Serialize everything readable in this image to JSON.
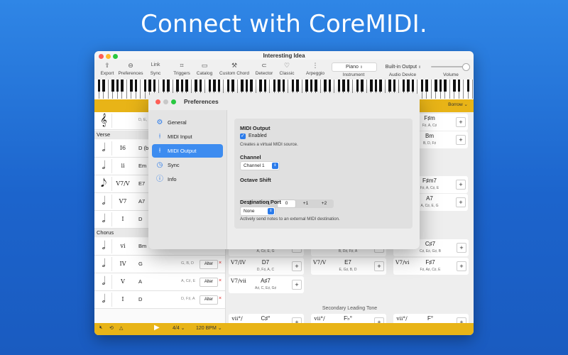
{
  "headline": "Connect with CoreMIDI.",
  "window": {
    "title": "Interesting Idea",
    "traffic_colors": [
      "#fe5f57",
      "#febc2e",
      "#28c840"
    ]
  },
  "toolbar": {
    "export": {
      "icon": "share-icon",
      "label": "Export"
    },
    "preferences": {
      "icon": "preferences-icon",
      "label": "Preferences"
    },
    "sync": {
      "text": "Link",
      "label": "Sync"
    },
    "triggers": {
      "icon": "triggers-icon",
      "label": "Triggers"
    },
    "catalog": {
      "icon": "book-icon",
      "label": "Catalog"
    },
    "custom_chord": {
      "icon": "hammer-icon",
      "label": "Custom Chord"
    },
    "detector": {
      "icon": "ear-icon",
      "label": "Detector"
    },
    "classic": {
      "icon": "heart-icon",
      "label": "Classic"
    },
    "arpeggio": {
      "icon": "dots-icon",
      "label": "Arpeggio"
    },
    "instrument": {
      "value": "Piano",
      "label": "Instrument"
    },
    "audio_device": {
      "value": "Built-in Output",
      "label": "Audio Device"
    },
    "volume": {
      "label": "Volume",
      "level": 0.85
    }
  },
  "borrow_label": "Borrow",
  "top_row": {
    "clef": "𝄞",
    "notes": "D, E,"
  },
  "sections": {
    "verse": "Verse",
    "chorus": "Chorus"
  },
  "verse_rows": [
    {
      "note": "𝅗𝅥",
      "numeral": "I6",
      "chord": "D (b",
      "notes": "",
      "alter": ""
    },
    {
      "note": "𝅗𝅥",
      "numeral": "ii",
      "chord": "Em",
      "notes": "",
      "alter": ""
    },
    {
      "note": "𝅘𝅥𝅮",
      "numeral": "V7/V",
      "chord": "E7",
      "notes": "",
      "alter": ""
    },
    {
      "note": "𝅗𝅥",
      "numeral": "V7",
      "chord": "A7",
      "notes": "",
      "alter": ""
    },
    {
      "note": "𝅗𝅥",
      "numeral": "I",
      "chord": "D",
      "notes": "",
      "alter": ""
    }
  ],
  "chorus_rows": [
    {
      "note": "𝅗𝅥",
      "numeral": "vi",
      "chord": "Bm",
      "notes": "",
      "alter": ""
    },
    {
      "note": "𝅗𝅥",
      "numeral": "IV",
      "chord": "G",
      "notes": "G, B, D",
      "alter": "Alter"
    },
    {
      "note": "𝅗𝅥",
      "numeral": "V",
      "chord": "A",
      "notes": "A, C♯, E",
      "alter": "Alter"
    },
    {
      "note": "𝅗𝅥",
      "numeral": "I",
      "chord": "D",
      "notes": "D, F♯, A",
      "alter": "Alter"
    }
  ],
  "right_cards_top": [
    {
      "roman": "",
      "chord": "F♯m",
      "notes": "F♯, A, C♯"
    },
    {
      "roman": "",
      "chord": "Bm",
      "notes": "B, D, F♯"
    }
  ],
  "right_cards_mid": [
    {
      "roman": "",
      "chord": "F♯m7",
      "notes": "F♯, A, C♯, E"
    },
    {
      "roman": "",
      "chord": "A7",
      "notes": "A, C♯, E, G"
    }
  ],
  "secondary_cards": [
    {
      "roman": "V7/I",
      "chord": "A7",
      "notes": "A, C♯, E, G"
    },
    {
      "roman": "V7/ii",
      "chord": "B7",
      "notes": "B, D♯, F♯, A"
    },
    {
      "roman": "V7/iii",
      "chord": "C♯7",
      "notes": "C♯, E♯, G♯, B"
    },
    {
      "roman": "V7/IV",
      "chord": "D7",
      "notes": "D, F♯, A, C"
    },
    {
      "roman": "V7/V",
      "chord": "E7",
      "notes": "E, G♯, B, D"
    },
    {
      "roman": "V7/vi",
      "chord": "F♯7",
      "notes": "F♯, A♯, C♯, E"
    },
    {
      "roman": "V7/vii",
      "chord": "A♯7",
      "notes": "A♯, C, E♯, G♯"
    }
  ],
  "secondary_heading": "Secondary Leading Tone",
  "leading_cards": [
    {
      "roman": "vii°/",
      "chord": "C♯°"
    },
    {
      "roman": "vii°/",
      "chord": "F♭°"
    },
    {
      "roman": "vii°/",
      "chord": "F°"
    }
  ],
  "bottombar": {
    "time_sig": "4/4",
    "tempo": "120 BPM"
  },
  "dialog": {
    "title": "Preferences",
    "traffic_colors": [
      "#fe5f57",
      "#c8c8c8",
      "#28c840"
    ],
    "sidebar": [
      {
        "icon": "gear-icon",
        "label": "General",
        "active": false
      },
      {
        "icon": "midi-input-icon",
        "label": "MIDI Input",
        "active": false
      },
      {
        "icon": "midi-output-icon",
        "label": "MIDI Output",
        "active": true
      },
      {
        "icon": "sync-icon",
        "label": "Sync",
        "active": false
      },
      {
        "icon": "info-icon",
        "label": "Info",
        "active": false
      }
    ],
    "midi_output": {
      "heading": "MIDI Output",
      "enabled_label": "Enabled",
      "enabled_checked": true,
      "enabled_desc": "Creates a virtual MIDI source.",
      "channel_heading": "Channel",
      "channel_value": "Channel 1",
      "octave_heading": "Octave Shift",
      "octave_options": [
        "-2",
        "-1",
        "0",
        "+1",
        "+2"
      ],
      "octave_selected": "0",
      "dest_heading": "Destination Port",
      "dest_value": "None",
      "dest_desc": "Actively send notes to an external MIDI destination."
    }
  }
}
